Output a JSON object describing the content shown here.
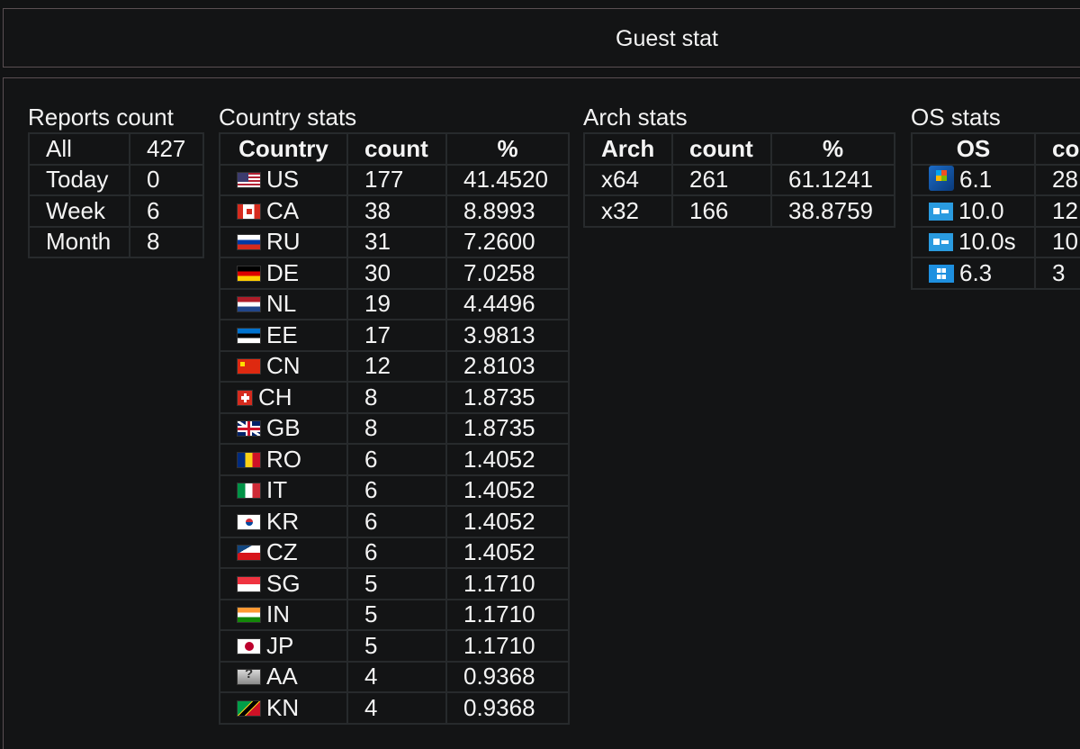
{
  "header": {
    "title": "Guest stat"
  },
  "reports": {
    "title": "Reports count",
    "rows": [
      {
        "label": "All",
        "value": "427"
      },
      {
        "label": "Today",
        "value": "0"
      },
      {
        "label": "Week",
        "value": "6"
      },
      {
        "label": "Month",
        "value": "8"
      }
    ]
  },
  "country": {
    "title": "Country stats",
    "headers": {
      "country": "Country",
      "count": "count",
      "pct": "%"
    },
    "rows": [
      {
        "flag": "US",
        "code": "US",
        "count": "177",
        "pct": "41.4520"
      },
      {
        "flag": "CA",
        "code": "CA",
        "count": "38",
        "pct": "8.8993"
      },
      {
        "flag": "RU",
        "code": "RU",
        "count": "31",
        "pct": "7.2600"
      },
      {
        "flag": "DE",
        "code": "DE",
        "count": "30",
        "pct": "7.0258"
      },
      {
        "flag": "NL",
        "code": "NL",
        "count": "19",
        "pct": "4.4496"
      },
      {
        "flag": "EE",
        "code": "EE",
        "count": "17",
        "pct": "3.9813"
      },
      {
        "flag": "CN",
        "code": "CN",
        "count": "12",
        "pct": "2.8103"
      },
      {
        "flag": "CH",
        "code": "CH",
        "count": "8",
        "pct": "1.8735"
      },
      {
        "flag": "GB",
        "code": "GB",
        "count": "8",
        "pct": "1.8735"
      },
      {
        "flag": "RO",
        "code": "RO",
        "count": "6",
        "pct": "1.4052"
      },
      {
        "flag": "IT",
        "code": "IT",
        "count": "6",
        "pct": "1.4052"
      },
      {
        "flag": "KR",
        "code": "KR",
        "count": "6",
        "pct": "1.4052"
      },
      {
        "flag": "CZ",
        "code": "CZ",
        "count": "6",
        "pct": "1.4052"
      },
      {
        "flag": "SG",
        "code": "SG",
        "count": "5",
        "pct": "1.1710"
      },
      {
        "flag": "IN",
        "code": "IN",
        "count": "5",
        "pct": "1.1710"
      },
      {
        "flag": "JP",
        "code": "JP",
        "count": "5",
        "pct": "1.1710"
      },
      {
        "flag": "AA",
        "code": "AA",
        "count": "4",
        "pct": "0.9368"
      },
      {
        "flag": "KN",
        "code": "KN",
        "count": "4",
        "pct": "0.9368"
      }
    ]
  },
  "arch": {
    "title": "Arch stats",
    "headers": {
      "arch": "Arch",
      "count": "count",
      "pct": "%"
    },
    "rows": [
      {
        "arch": "x64",
        "count": "261",
        "pct": "61.1241"
      },
      {
        "arch": "x32",
        "count": "166",
        "pct": "38.8759"
      }
    ]
  },
  "os": {
    "title": "OS stats",
    "headers": {
      "os": "OS",
      "count": "co"
    },
    "rows": [
      {
        "icon": "windows-7-logo-icon",
        "version": "6.1",
        "count": "28"
      },
      {
        "icon": "windows-10-logo-icon",
        "version": "10.0",
        "count": "12"
      },
      {
        "icon": "windows-10-logo-icon",
        "version": "10.0s",
        "count": "10"
      },
      {
        "icon": "windows-8-logo-icon",
        "version": "6.3",
        "count": "3"
      }
    ]
  },
  "colors": {
    "background": "#121314",
    "panel_border": "#5a4f52",
    "grid_border": "#272a2c",
    "text": "#f4f4f4"
  }
}
